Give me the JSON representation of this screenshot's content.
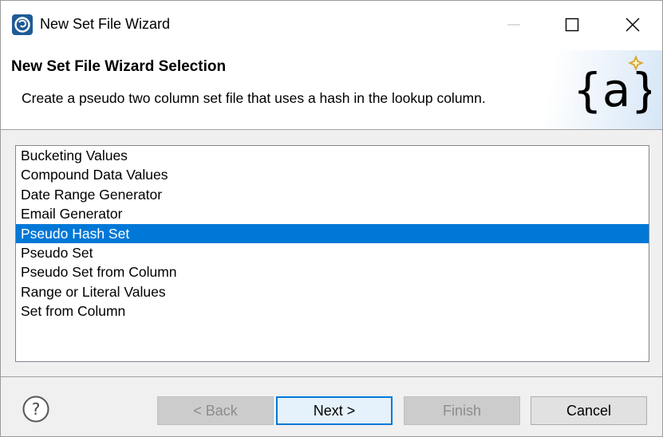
{
  "window": {
    "title": "New Set File Wizard"
  },
  "banner": {
    "title": "New Set File Wizard Selection",
    "description": "Create a pseudo two column set file that uses a hash in the lookup column.",
    "logo_text": "{a}"
  },
  "list": {
    "items": [
      "Bucketing Values",
      "Compound Data Values",
      "Date Range Generator",
      "Email Generator",
      "Pseudo Hash Set",
      "Pseudo Set",
      "Pseudo Set from Column",
      "Range or Literal Values",
      "Set from Column"
    ],
    "selected": "Pseudo Hash Set"
  },
  "buttons": {
    "back": "< Back",
    "next": "Next >",
    "finish": "Finish",
    "cancel": "Cancel"
  },
  "colors": {
    "selection": "#0078d7",
    "logo_star": "#d8a83a"
  }
}
